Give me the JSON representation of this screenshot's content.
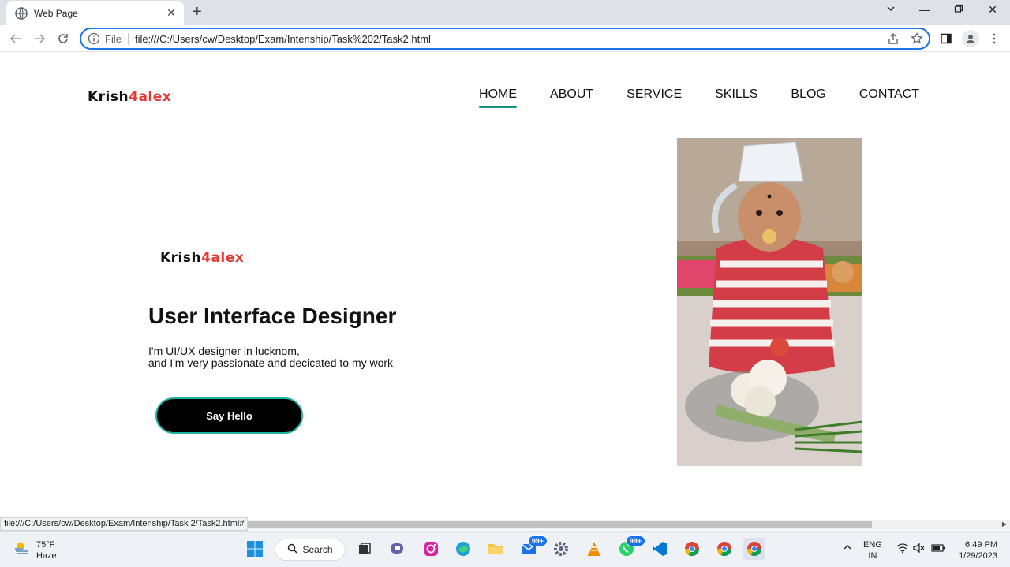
{
  "browser": {
    "tab_title": "Web Page",
    "scheme_label": "File",
    "url": "file:///C:/Users/cw/Desktop/Exam/Intenship/Task%202/Task2.html",
    "status_url": "file:///C:/Users/cw/Desktop/Exam/Intenship/Task 2/Task2.html#"
  },
  "site": {
    "logo_part1": "Krish",
    "logo_part2": "4alex",
    "nav": [
      {
        "label": "HOME",
        "active": true
      },
      {
        "label": "ABOUT",
        "active": false
      },
      {
        "label": "SERVICE",
        "active": false
      },
      {
        "label": "SKILLS",
        "active": false
      },
      {
        "label": "BLOG",
        "active": false
      },
      {
        "label": "CONTACT",
        "active": false
      }
    ],
    "hero": {
      "logo_part1": "Krish",
      "logo_part2": "4alex",
      "title": "User Interface Designer",
      "line1": "I'm UI/UX designer in lucknom,",
      "line2": "and I'm very passionate and decicated to my work",
      "button": "Say Hello"
    },
    "colors": {
      "accent": "#1a9187",
      "logo_red": "#e53935",
      "button_border": "#1fb0a0"
    }
  },
  "taskbar": {
    "weather_temp": "75°F",
    "weather_desc": "Haze",
    "search_label": "Search",
    "badge_mail": "99+",
    "badge_whatsapp": "99+",
    "lang": "ENG",
    "region": "IN",
    "time": "6:49 PM",
    "date": "1/29/2023"
  }
}
